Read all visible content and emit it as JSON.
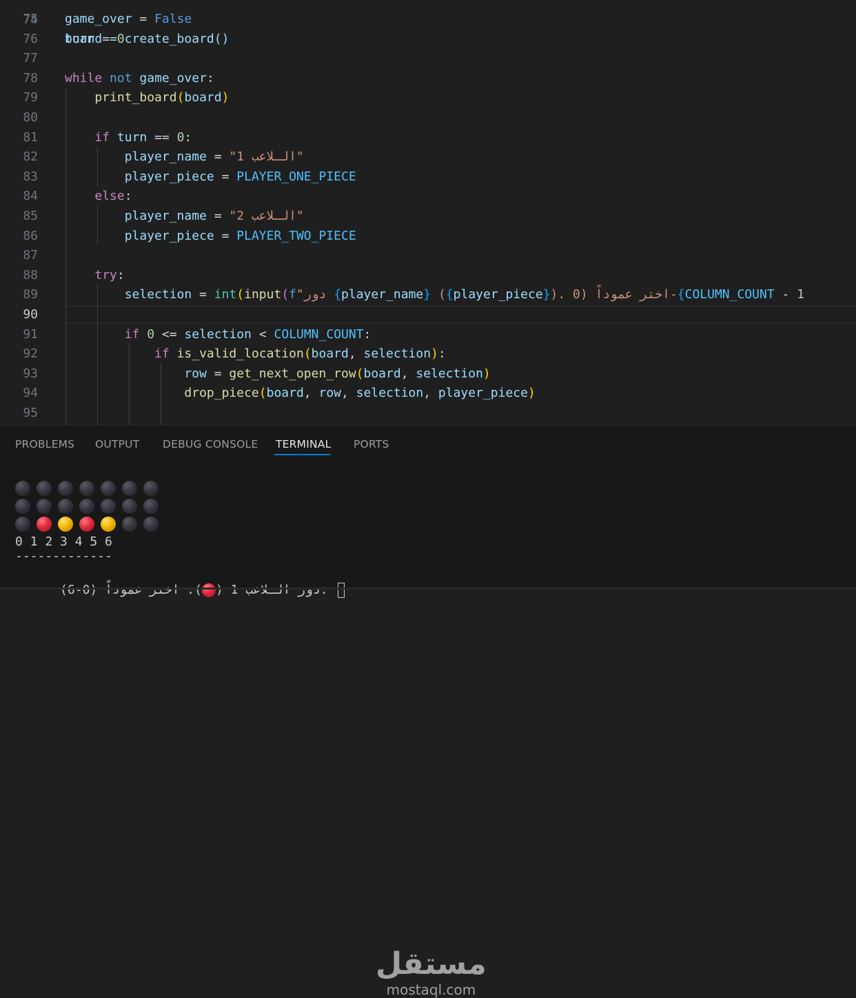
{
  "editor": {
    "partial_top": "board = create_board()",
    "lines": [
      {
        "n": "75",
        "parts": [
          [
            "var",
            "game_over"
          ],
          [
            "op",
            " = "
          ],
          [
            "kw2",
            "False"
          ]
        ]
      },
      {
        "n": "76",
        "parts": [
          [
            "var",
            "turn"
          ],
          [
            "op",
            " = "
          ],
          [
            "num",
            "0"
          ]
        ]
      },
      {
        "n": "77",
        "parts": []
      },
      {
        "n": "78",
        "parts": [
          [
            "kw",
            "while"
          ],
          [
            "op",
            " "
          ],
          [
            "kw2",
            "not"
          ],
          [
            "op",
            " "
          ],
          [
            "var",
            "game_over"
          ],
          [
            "op",
            ":"
          ]
        ]
      },
      {
        "n": "79",
        "parts": [
          [
            "op",
            "    "
          ],
          [
            "fn",
            "print_board"
          ],
          [
            "br1",
            "("
          ],
          [
            "var",
            "board"
          ],
          [
            "br1",
            ")"
          ]
        ]
      },
      {
        "n": "80",
        "parts": []
      },
      {
        "n": "81",
        "parts": [
          [
            "op",
            "    "
          ],
          [
            "kw",
            "if"
          ],
          [
            "op",
            " "
          ],
          [
            "var",
            "turn"
          ],
          [
            "op",
            " == "
          ],
          [
            "num",
            "0"
          ],
          [
            "op",
            ":"
          ]
        ]
      },
      {
        "n": "82",
        "parts": [
          [
            "op",
            "        "
          ],
          [
            "var",
            "player_name"
          ],
          [
            "op",
            " = "
          ],
          [
            "str",
            "\"الـلاعب 1\""
          ]
        ]
      },
      {
        "n": "83",
        "parts": [
          [
            "op",
            "        "
          ],
          [
            "var",
            "player_piece"
          ],
          [
            "op",
            " = "
          ],
          [
            "cst",
            "PLAYER_ONE_PIECE"
          ]
        ]
      },
      {
        "n": "84",
        "parts": [
          [
            "op",
            "    "
          ],
          [
            "kw",
            "else"
          ],
          [
            "op",
            ":"
          ]
        ]
      },
      {
        "n": "85",
        "parts": [
          [
            "op",
            "        "
          ],
          [
            "var",
            "player_name"
          ],
          [
            "op",
            " = "
          ],
          [
            "str",
            "\"الـلاعب 2\""
          ]
        ]
      },
      {
        "n": "86",
        "parts": [
          [
            "op",
            "        "
          ],
          [
            "var",
            "player_piece"
          ],
          [
            "op",
            " = "
          ],
          [
            "cst",
            "PLAYER_TWO_PIECE"
          ]
        ]
      },
      {
        "n": "87",
        "parts": []
      },
      {
        "n": "88",
        "parts": [
          [
            "op",
            "    "
          ],
          [
            "kw",
            "try"
          ],
          [
            "op",
            ":"
          ]
        ]
      },
      {
        "n": "89",
        "parts": [
          [
            "op",
            "        "
          ],
          [
            "var",
            "selection"
          ],
          [
            "op",
            " = "
          ],
          [
            "bi",
            "int"
          ],
          [
            "br1",
            "("
          ],
          [
            "fn",
            "input"
          ],
          [
            "br2",
            "("
          ],
          [
            "kw2",
            "f"
          ],
          [
            "str",
            "\"دور "
          ],
          [
            "br3",
            "{"
          ],
          [
            "var",
            "player_name"
          ],
          [
            "br3",
            "}"
          ],
          [
            "str",
            " ("
          ],
          [
            "br3",
            "{"
          ],
          [
            "var",
            "player_piece"
          ],
          [
            "br3",
            "}"
          ],
          [
            "str",
            "). اختر عموداً (0-"
          ],
          [
            "br3",
            "{"
          ],
          [
            "cst",
            "COLUMN_COUNT"
          ],
          [
            "op",
            " - "
          ],
          [
            "num",
            "1"
          ]
        ]
      },
      {
        "n": "90",
        "parts": []
      },
      {
        "n": "91",
        "parts": [
          [
            "op",
            "        "
          ],
          [
            "kw",
            "if"
          ],
          [
            "op",
            " "
          ],
          [
            "num",
            "0"
          ],
          [
            "op",
            " <= "
          ],
          [
            "var",
            "selection"
          ],
          [
            "op",
            " < "
          ],
          [
            "cst",
            "COLUMN_COUNT"
          ],
          [
            "op",
            ":"
          ]
        ]
      },
      {
        "n": "92",
        "parts": [
          [
            "op",
            "            "
          ],
          [
            "kw",
            "if"
          ],
          [
            "op",
            " "
          ],
          [
            "fn",
            "is_valid_location"
          ],
          [
            "br1",
            "("
          ],
          [
            "var",
            "board"
          ],
          [
            "op",
            ", "
          ],
          [
            "var",
            "selection"
          ],
          [
            "br1",
            ")"
          ],
          [
            "op",
            ":"
          ]
        ]
      },
      {
        "n": "93",
        "parts": [
          [
            "op",
            "                "
          ],
          [
            "var",
            "row"
          ],
          [
            "op",
            " = "
          ],
          [
            "fn",
            "get_next_open_row"
          ],
          [
            "br1",
            "("
          ],
          [
            "var",
            "board"
          ],
          [
            "op",
            ", "
          ],
          [
            "var",
            "selection"
          ],
          [
            "br1",
            ")"
          ]
        ]
      },
      {
        "n": "94",
        "parts": [
          [
            "op",
            "                "
          ],
          [
            "fn",
            "drop_piece"
          ],
          [
            "br1",
            "("
          ],
          [
            "var",
            "board"
          ],
          [
            "op",
            ", "
          ],
          [
            "var",
            "row"
          ],
          [
            "op",
            ", "
          ],
          [
            "var",
            "selection"
          ],
          [
            "op",
            ", "
          ],
          [
            "var",
            "player_piece"
          ],
          [
            "br1",
            ")"
          ]
        ]
      },
      {
        "n": "95",
        "parts": []
      }
    ],
    "active_line": "90"
  },
  "panel": {
    "tabs": [
      {
        "label": "PROBLEMS",
        "active": false
      },
      {
        "label": "OUTPUT",
        "active": false
      },
      {
        "label": "DEBUG CONSOLE",
        "active": false
      },
      {
        "label": "TERMINAL",
        "active": true
      },
      {
        "label": "PORTS",
        "active": false
      }
    ]
  },
  "terminal": {
    "board": [
      [
        "empty",
        "empty",
        "empty",
        "empty",
        "empty",
        "empty",
        "empty"
      ],
      [
        "empty",
        "empty",
        "empty",
        "empty",
        "empty",
        "empty",
        "empty"
      ],
      [
        "empty",
        "red",
        "yellow",
        "red",
        "yellow",
        "empty",
        "empty"
      ]
    ],
    "column_numbers": "0 1 2 3 4 5 6",
    "separator": "-------------",
    "prompt_before": "دور الـلاعب 1 (",
    "prompt_after": "). اختر عموداً (0-6): "
  },
  "watermark": {
    "arabic": "مستقل",
    "latin": "mostaql.com"
  },
  "colors": {
    "background": "#1f1f1f",
    "panel_background": "#181818",
    "active_tab_underline": "#0078d4"
  }
}
